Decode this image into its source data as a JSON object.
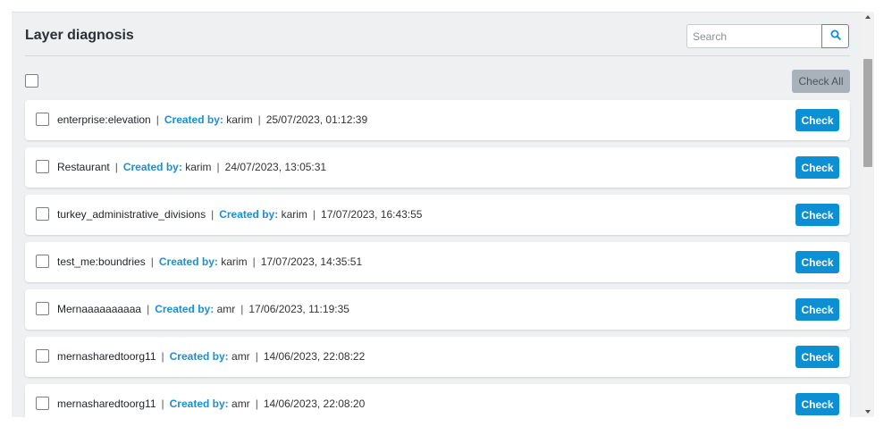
{
  "header": {
    "title": "Layer diagnosis",
    "search_placeholder": "Search"
  },
  "toolbar": {
    "check_all_label": "Check All"
  },
  "colors": {
    "accent": "#0d8fd3",
    "created_label": "#1b8fd0",
    "disabled_button": "#a9b2ba"
  },
  "layers": [
    {
      "name": "enterprise:elevation",
      "created_label": "Created by:",
      "created_by": "karim",
      "date": "25/07/2023, 01:12:39",
      "button": "Check"
    },
    {
      "name": "Restaurant",
      "created_label": "Created by:",
      "created_by": "karim",
      "date": "24/07/2023, 13:05:31",
      "button": "Check"
    },
    {
      "name": "turkey_administrative_divisions",
      "created_label": "Created by:",
      "created_by": "karim",
      "date": "17/07/2023, 16:43:55",
      "button": "Check"
    },
    {
      "name": "test_me:boundries",
      "created_label": "Created by:",
      "created_by": "karim",
      "date": "17/07/2023, 14:35:51",
      "button": "Check"
    },
    {
      "name": "Mernaaaaaaaaaa",
      "created_label": "Created by:",
      "created_by": "amr",
      "date": "17/06/2023, 11:19:35",
      "button": "Check"
    },
    {
      "name": "mernasharedtoorg11",
      "created_label": "Created by:",
      "created_by": "amr",
      "date": "14/06/2023, 22:08:22",
      "button": "Check"
    },
    {
      "name": "mernasharedtoorg11",
      "created_label": "Created by:",
      "created_by": "amr",
      "date": "14/06/2023, 22:08:20",
      "button": "Check"
    }
  ]
}
